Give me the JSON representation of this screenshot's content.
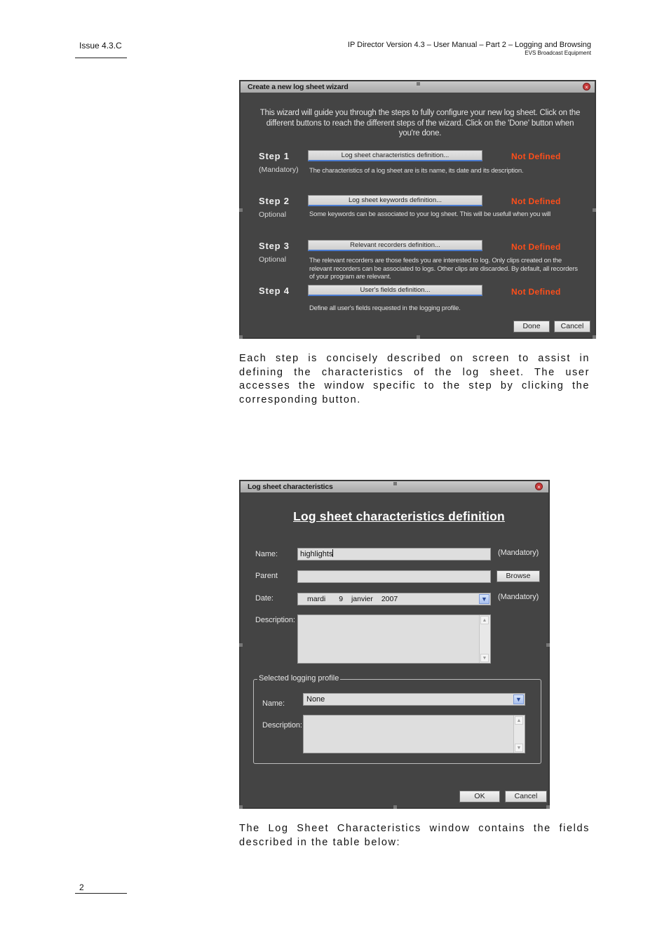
{
  "header": {
    "issue": "Issue 4.3.C",
    "manual_title": "IP Director Version 4.3 – User Manual – Part 2 – Logging and Browsing",
    "company": "EVS Broadcast Equipment"
  },
  "footer": {
    "page_number": "2"
  },
  "wizard": {
    "title": "Create a new log sheet wizard",
    "intro": "This wizard will guide you through the steps to fully configure your new log sheet. Click on the different buttons to reach the different steps of the wizard. Click on the 'Done' button when you're done.",
    "steps": [
      {
        "label": "Step 1",
        "sub": "(Mandatory)",
        "button": "Log sheet characteristics definition...",
        "status": "Not Defined",
        "description": "The characteristics of a log sheet are is its name, its date and its description."
      },
      {
        "label": "Step 2",
        "sub": "Optional",
        "button": "Log sheet keywords definition...",
        "status": "Not Defined",
        "description": "Some keywords can be associated to your log sheet. This will be usefull when you will"
      },
      {
        "label": "Step 3",
        "sub": "Optional",
        "button": "Relevant recorders definition...",
        "status": "Not Defined",
        "description": "The relevant recorders are those feeds you are interested to log. Only clips created on the relevant recorders can be associated to logs. Other clips are discarded. By default, all recorders of your program are relevant."
      },
      {
        "label": "Step 4",
        "sub": "",
        "button": "User's fields definition...",
        "status": "Not Defined",
        "description": "Define all user's fields requested in the logging profile."
      }
    ],
    "done_label": "Done",
    "cancel_label": "Cancel"
  },
  "paragraph1": "Each step is concisely described on screen to assist in defining the characteristics of the log sheet. The user accesses the window specific to the step by clicking the corresponding button.",
  "characteristics": {
    "title": "Log sheet characteristics",
    "heading": "Log sheet characteristics definition",
    "name_label": "Name:",
    "name_value": "highlights",
    "mandatory_label": "(Mandatory)",
    "parent_label": "Parent",
    "parent_value": "",
    "browse_label": "Browse",
    "date_label": "Date:",
    "date_value": {
      "weekday": "mardi",
      "day": "9",
      "month": "janvier",
      "year": "2007"
    },
    "description_label": "Description:",
    "profile": {
      "group_label": "Selected logging profile",
      "name_label": "Name:",
      "name_value": "None",
      "description_label": "Description:"
    },
    "ok_label": "OK",
    "cancel_label": "Cancel"
  },
  "paragraph2": "The Log Sheet Characteristics window contains the fields described in the table below:"
}
